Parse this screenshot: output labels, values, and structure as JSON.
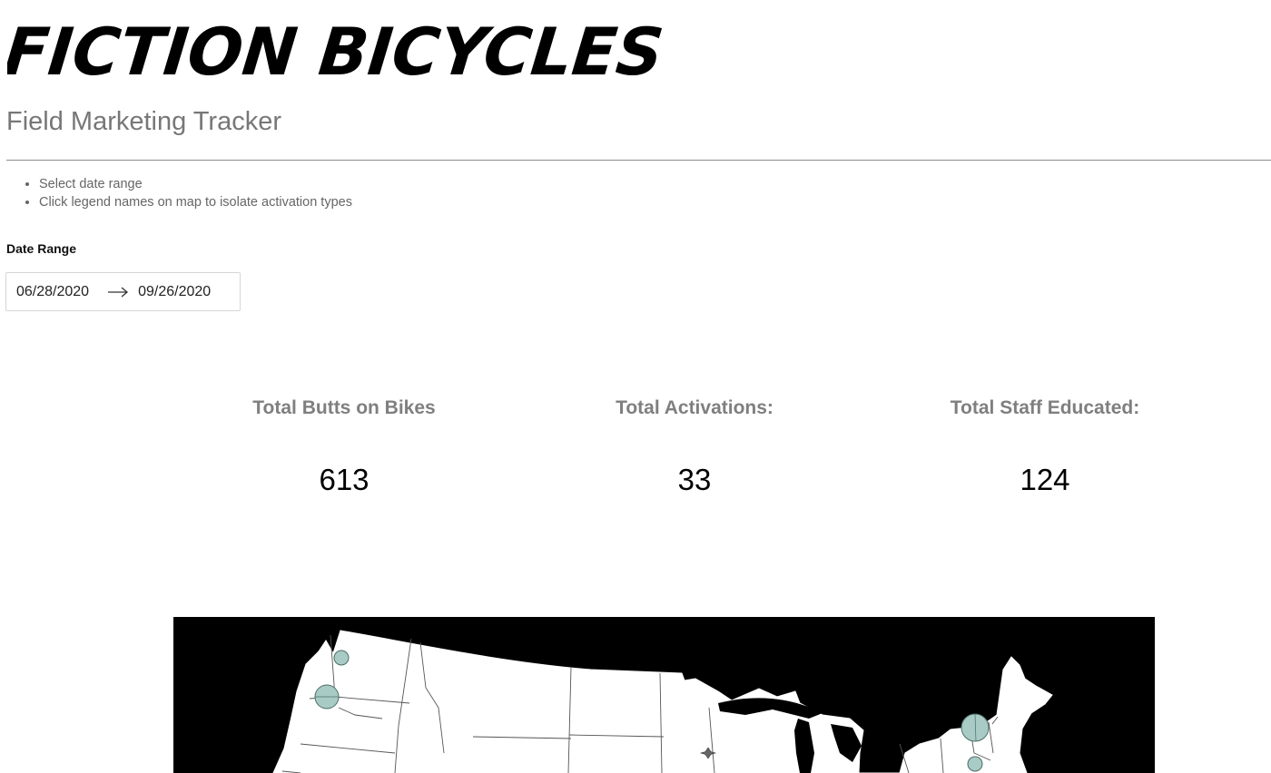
{
  "brand": {
    "logo_text": "FICTION BICYCLES"
  },
  "header": {
    "title": "Field Marketing Tracker"
  },
  "instructions": [
    "Select date range",
    "Click legend names on map to isolate activation types"
  ],
  "date_range": {
    "label": "Date Range",
    "start": "06/28/2020",
    "end": "09/26/2020",
    "arrow_icon": "arrow-right-icon"
  },
  "kpis": [
    {
      "label": "Total Butts on Bikes",
      "value": "613"
    },
    {
      "label": "Total Activations:",
      "value": "33"
    },
    {
      "label": "Total Staff Educated:",
      "value": "124"
    }
  ],
  "map": {
    "background_color": "#000000",
    "land_color": "#ffffff",
    "marker_color": "#a9cbc5",
    "markers": [
      {
        "place": "Seattle"
      },
      {
        "place": "Portland"
      },
      {
        "place": "Vermont"
      },
      {
        "place": "Western Massachusetts"
      }
    ]
  }
}
